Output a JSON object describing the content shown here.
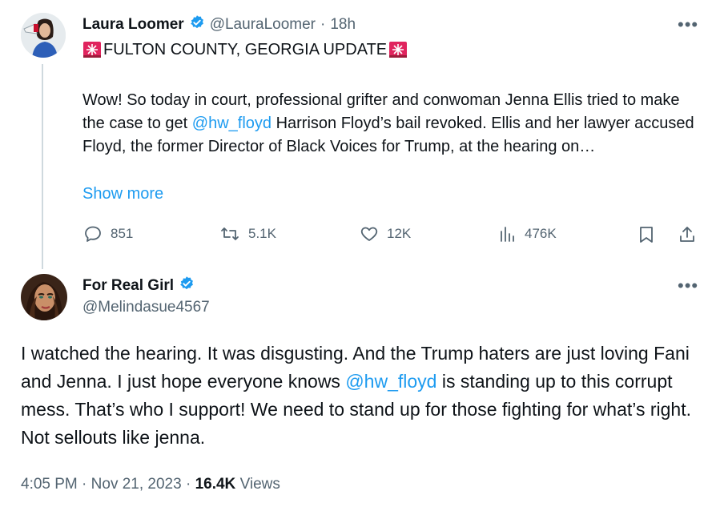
{
  "colors": {
    "accent": "#1d9bf0",
    "muted": "#536471",
    "text": "#0f1419",
    "verified": "#1d9bf0"
  },
  "tweet1": {
    "name": "Laura Loomer",
    "handle": "@LauraLoomer",
    "sep": "·",
    "time": "18h",
    "headline": "FULTON COUNTY, GEORGIA UPDATE",
    "headline_icon": "police-light-emoji",
    "body_before": "Wow! So today in court, professional grifter and conwoman Jenna Ellis tried to make the case to get ",
    "mention": "@hw_floyd",
    "body_after": " Harrison Floyd’s bail revoked. Ellis and her lawyer accused Floyd, the former Director of Black Voices for Trump, at the hearing on…",
    "show_more": "Show more",
    "replies": "851",
    "retweets": "5.1K",
    "likes": "12K",
    "views": "476K",
    "more_icon": "more-dots-icon"
  },
  "tweet2": {
    "name": "For Real Girl",
    "handle": "@Melindasue4567",
    "body_before": "I watched the hearing. It was disgusting. And the Trump haters are just loving Fani and Jenna. I just hope everyone knows ",
    "mention": "@hw_floyd",
    "body_after": " is standing up to this corrupt mess. That’s who I support! We need to stand up for those fighting for what’s right. Not sellouts like jenna.",
    "time": "4:05 PM",
    "date": "Nov 21, 2023",
    "sep": "·",
    "views_count": "16.4K",
    "views_label": "Views"
  }
}
